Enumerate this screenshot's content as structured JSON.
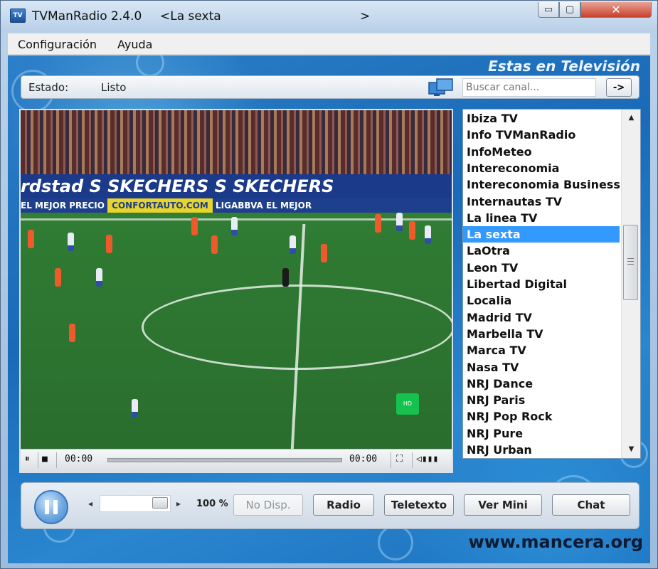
{
  "window": {
    "app_title": "TVManRadio 2.4.0",
    "channel_title": "<La sexta",
    "title_arrow": ">",
    "icon_text": "TV",
    "minimize": "▭",
    "maximize": "▢",
    "close": "✕"
  },
  "menu": {
    "items": [
      {
        "label": "Configuración"
      },
      {
        "label": "Ayuda"
      }
    ]
  },
  "tagline": "Estas en Televisión",
  "status": {
    "label": "Estado:",
    "value": "Listo"
  },
  "search": {
    "placeholder": "Buscar canal...",
    "go_label": "->"
  },
  "player": {
    "time_current": "00:00",
    "time_total": "00:00",
    "ad_board": "rdstad  S SKECHERS  S SKECHERS",
    "ad_board2_left": "EL MEJOR PRECIO",
    "ad_board2_yellow": "CONFORTAUTO.COM",
    "ad_board2_right": "LIGABBVA   EL MEJOR",
    "badge_text": "HD"
  },
  "channels": {
    "items": [
      "Ibiza TV",
      "Info TVManRadio",
      "InfoMeteo",
      "Intereconomia",
      "Intereconomia Business",
      "Internautas TV",
      "La linea TV",
      "La sexta",
      "LaOtra",
      "Leon TV",
      "Libertad Digital",
      "Localia",
      "Madrid TV",
      "Marbella TV",
      "Marca TV",
      "Nasa TV",
      "NRJ Dance",
      "NRJ Paris",
      "NRJ Pop Rock",
      "NRJ Pure",
      "NRJ Urban"
    ],
    "selected": "La sexta",
    "scroll_up": "▲",
    "scroll_down": "▼"
  },
  "volume": {
    "left_arrow": "◂",
    "right_arrow": "▸",
    "percent_label": "100 %",
    "level": 1.0
  },
  "buttons": {
    "no_disp": "No Disp.",
    "radio": "Radio",
    "teletexto": "Teletexto",
    "ver_mini": "Ver Mini",
    "chat": "Chat"
  },
  "website": "www.mancera.org",
  "colors": {
    "accent": "#3399ff",
    "background": "#1a6ab7"
  }
}
